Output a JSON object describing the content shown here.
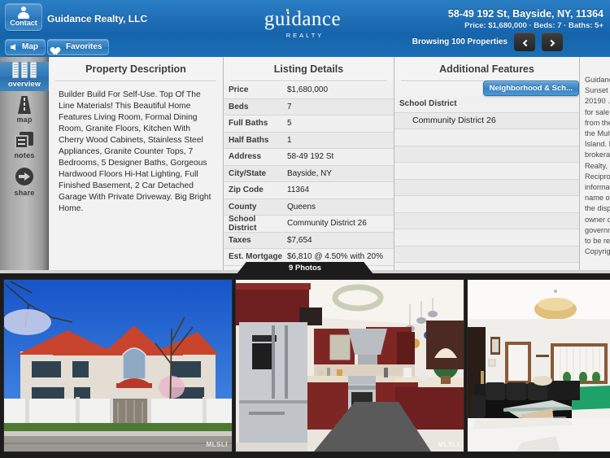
{
  "header": {
    "contact_label": "Contact",
    "company": "Guidance Realty, LLC",
    "map_label": "Map",
    "favorites_label": "Favorites",
    "logo_name": "guidance",
    "logo_sub": "REALTY",
    "address": "58-49 192 St, Bayside, NY, 11364",
    "stats": "Price: $1,680,000 · Beds: 7 · Baths: 5+",
    "browsing": "Browsing 100 Properties",
    "prev_label": "‹",
    "next_label": "›",
    "accent_color": "#1e6db4"
  },
  "sidebar": {
    "items": [
      {
        "label": "overview",
        "icon": "overview-icon",
        "active": true
      },
      {
        "label": "map",
        "icon": "road-map-icon",
        "active": false
      },
      {
        "label": "notes",
        "icon": "notes-icon",
        "active": false
      },
      {
        "label": "share",
        "icon": "share-arrow-icon",
        "active": false
      }
    ]
  },
  "description_panel": {
    "title": "Property Description",
    "body": "Builder Build For Self-Use. Top Of The Line Materials! This Beautiful Home Features Living Room, Formal Dining Room, Granite Floors, Kitchen With Cherry Wood Cabinets, Stainless Steel Appliances, Granite Counter Tops, 7 Bedrooms, 5 Designer Baths, Gorgeous Hardwood Floors Hi-Hat Lighting, Full Finished Basement, 2 Car Detached Garage With Private Driveway. Big Bright Home."
  },
  "listing_panel": {
    "title": "Listing Details",
    "rows": [
      {
        "key": "Price",
        "value": "$1,680,000"
      },
      {
        "key": "Beds",
        "value": "7"
      },
      {
        "key": "Full Baths",
        "value": "5"
      },
      {
        "key": "Half Baths",
        "value": "1"
      },
      {
        "key": "Address",
        "value": "58-49 192 St"
      },
      {
        "key": "City/State",
        "value": "Bayside, NY"
      },
      {
        "key": "Zip Code",
        "value": "11364"
      },
      {
        "key": "County",
        "value": "Queens"
      },
      {
        "key": "School District",
        "value": "Community District 26"
      },
      {
        "key": "Taxes",
        "value": "$7,654"
      },
      {
        "key": "Est. Mortgage",
        "value": "$6,810 @ 4.50% with 20%"
      }
    ]
  },
  "additional_panel": {
    "title": "Additional Features",
    "tag_button": "Neighborhood & Sch...",
    "group_header": "School District",
    "group_value": "Community District 26",
    "empty_rows": 9
  },
  "disclaimer_panel": {
    "text": "Guidance\nSunset H\n20190 . T\nfor sale o\nfrom the\nthe Multi\nIsland. R\nbrokerag\nRealty, L\nReciproc\ninformati\nname of\nthe displ\nowner or\ngovernm\nto be reli\nCopyright"
  },
  "photos": {
    "banner": "9 Photos",
    "items": [
      {
        "name": "exterior-front-photo",
        "watermark": "MLSLI"
      },
      {
        "name": "kitchen-photo",
        "watermark": "MLSLI"
      },
      {
        "name": "living-room-photo",
        "watermark": ""
      }
    ]
  }
}
